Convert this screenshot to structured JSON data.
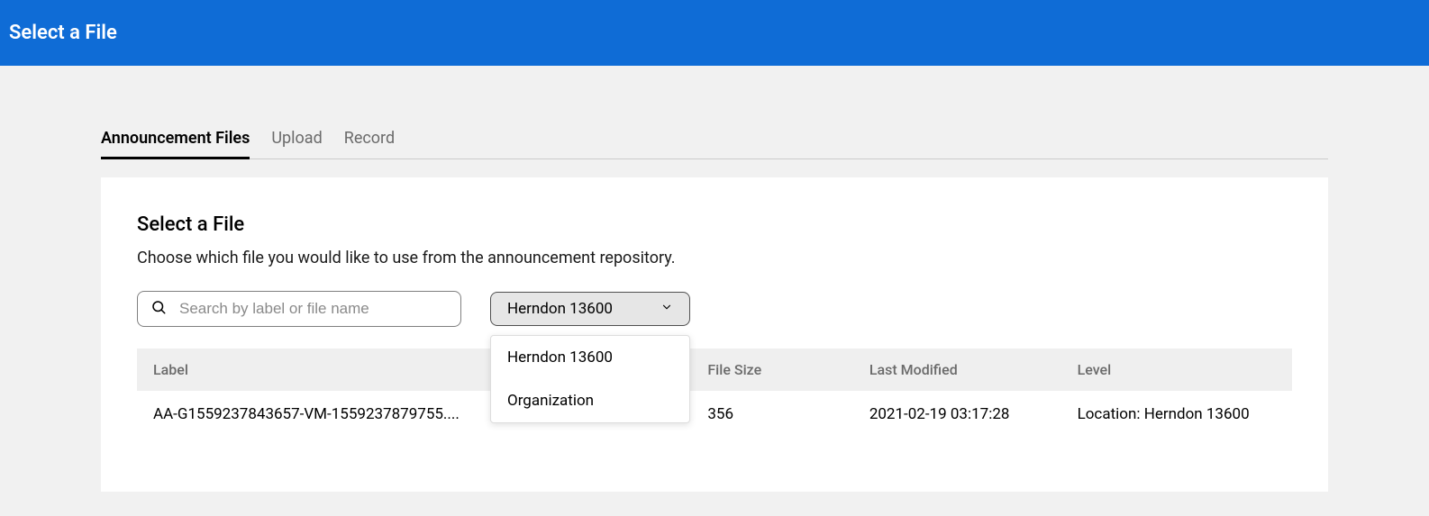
{
  "header": {
    "title": "Select a File"
  },
  "tabs": [
    {
      "label": "Announcement Files",
      "active": true
    },
    {
      "label": "Upload",
      "active": false
    },
    {
      "label": "Record",
      "active": false
    }
  ],
  "panel": {
    "title": "Select a File",
    "description": "Choose which file you would like to use from the announcement repository."
  },
  "search": {
    "placeholder": "Search by label or file name"
  },
  "dropdown": {
    "selected": "Herndon 13600",
    "options": [
      "Herndon 13600",
      "Organization"
    ]
  },
  "table": {
    "headers": {
      "label": "Label",
      "size": "File Size",
      "modified": "Last Modified",
      "level": "Level"
    },
    "rows": [
      {
        "label": "AA-G1559237843657-VM-1559237879755....",
        "size": "356",
        "modified": "2021-02-19 03:17:28",
        "level": "Location: Herndon 13600"
      }
    ]
  }
}
